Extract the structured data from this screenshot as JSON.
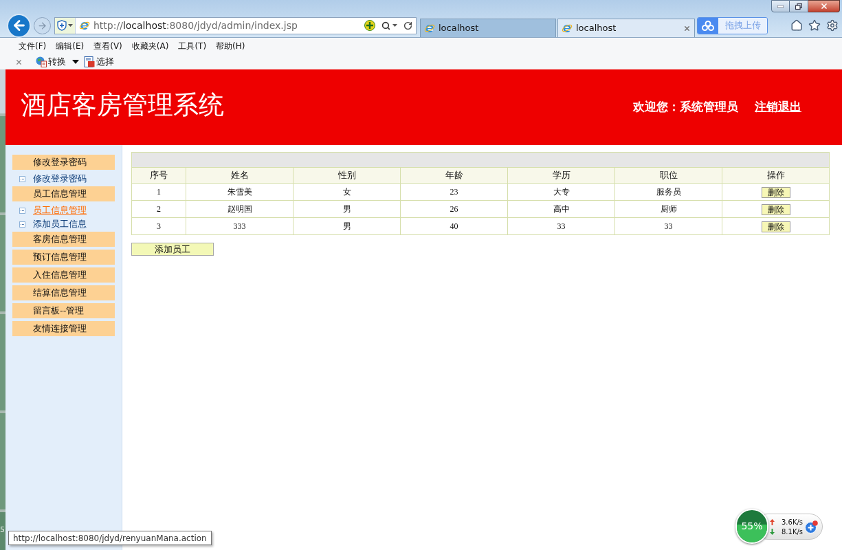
{
  "background_window": {
    "fragment": "5"
  },
  "browser": {
    "address": {
      "scheme": "http://",
      "host": "localhost",
      "path": ":8080/jdyd/admin/index.jsp"
    },
    "tabs": [
      {
        "label": "localhost",
        "selected": false
      },
      {
        "label": "localhost",
        "selected": true
      }
    ],
    "upload_button": "拖拽上传",
    "menu": [
      "文件(F)",
      "编辑(E)",
      "查看(V)",
      "收藏夹(A)",
      "工具(T)",
      "帮助(H)"
    ],
    "toolbar": [
      {
        "kind": "convert",
        "label": "转换",
        "dropdown": true
      },
      {
        "kind": "select",
        "label": "选择",
        "dropdown": false
      }
    ]
  },
  "header": {
    "title": "酒店客房管理系统",
    "welcome": "欢迎您：系统管理员",
    "logout": "注销退出"
  },
  "sidebar": {
    "groups": [
      {
        "label": "修改登录密码",
        "children": [
          {
            "label": "修改登录密码",
            "selected": false
          }
        ]
      },
      {
        "label": "员工信息管理",
        "children": [
          {
            "label": "员工信息管理",
            "selected": true
          },
          {
            "label": "添加员工信息",
            "selected": false
          }
        ]
      },
      {
        "label": "客房信息管理"
      },
      {
        "label": "预订信息管理"
      },
      {
        "label": "入住信息管理"
      },
      {
        "label": "结算信息管理"
      },
      {
        "label": "留言板--管理"
      },
      {
        "label": "友情连接管理"
      }
    ]
  },
  "table": {
    "columns": [
      "序号",
      "姓名",
      "性别",
      "年龄",
      "学历",
      "职位",
      "操作"
    ],
    "rows": [
      {
        "cells": [
          "1",
          "朱雪美",
          "女",
          "23",
          "大专",
          "服务员"
        ],
        "action": "删除"
      },
      {
        "cells": [
          "2",
          "赵明国",
          "男",
          "26",
          "高中",
          "厨师"
        ],
        "action": "删除"
      },
      {
        "cells": [
          "3",
          "333",
          "男",
          "40",
          "33",
          "33"
        ],
        "action": "删除"
      }
    ]
  },
  "add_button": "添加员工",
  "status_tooltip": "http://localhost:8080/jdyd/renyuanMana.action",
  "system_monitor": {
    "usage": "55%",
    "level": 0.55,
    "upload_rate": "3.6K/s",
    "download_rate": "8.1K/s"
  }
}
